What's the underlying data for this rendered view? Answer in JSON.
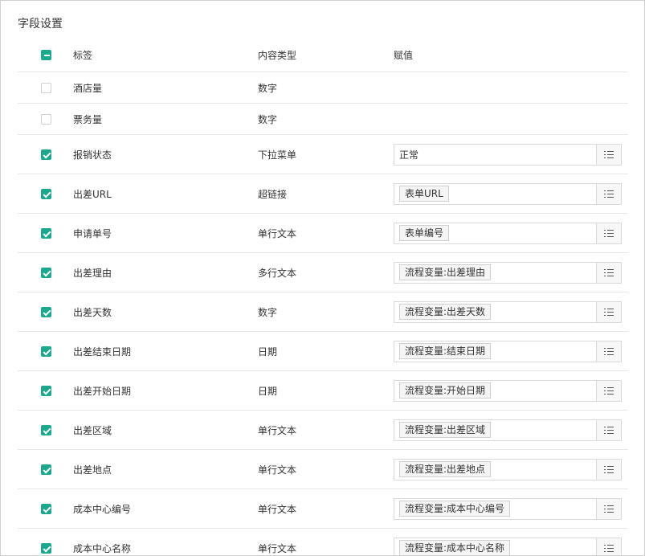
{
  "section_title": "字段设置",
  "columns": {
    "label": "标签",
    "type": "内容类型",
    "value": "赋值"
  },
  "rows": [
    {
      "label": "酒店量",
      "type": "数字",
      "checked": false,
      "value": "",
      "value_style": "none"
    },
    {
      "label": "票务量",
      "type": "数字",
      "checked": false,
      "value": "",
      "value_style": "none"
    },
    {
      "label": "报销状态",
      "type": "下拉菜单",
      "checked": true,
      "value": "正常",
      "value_style": "text"
    },
    {
      "label": "出差URL",
      "type": "超链接",
      "checked": true,
      "value": "表单URL",
      "value_style": "tag"
    },
    {
      "label": "申请单号",
      "type": "单行文本",
      "checked": true,
      "value": "表单编号",
      "value_style": "tag"
    },
    {
      "label": "出差理由",
      "type": "多行文本",
      "checked": true,
      "value": "流程变量:出差理由",
      "value_style": "tag"
    },
    {
      "label": "出差天数",
      "type": "数字",
      "checked": true,
      "value": "流程变量:出差天数",
      "value_style": "tag"
    },
    {
      "label": "出差结束日期",
      "type": "日期",
      "checked": true,
      "value": "流程变量:结束日期",
      "value_style": "tag"
    },
    {
      "label": "出差开始日期",
      "type": "日期",
      "checked": true,
      "value": "流程变量:开始日期",
      "value_style": "tag"
    },
    {
      "label": "出差区域",
      "type": "单行文本",
      "checked": true,
      "value": "流程变量:出差区域",
      "value_style": "tag"
    },
    {
      "label": "出差地点",
      "type": "单行文本",
      "checked": true,
      "value": "流程变量:出差地点",
      "value_style": "tag"
    },
    {
      "label": "成本中心编号",
      "type": "单行文本",
      "checked": true,
      "value": "流程变量:成本中心编号",
      "value_style": "tag"
    },
    {
      "label": "成本中心名称",
      "type": "单行文本",
      "checked": true,
      "value": "流程变量:成本中心名称",
      "value_style": "tag"
    }
  ],
  "colors": {
    "accent": "#1aa98d",
    "border": "#e8e8e8"
  },
  "icons": {
    "select_all": "partial-checkbox-icon",
    "picker": "list-icon"
  }
}
